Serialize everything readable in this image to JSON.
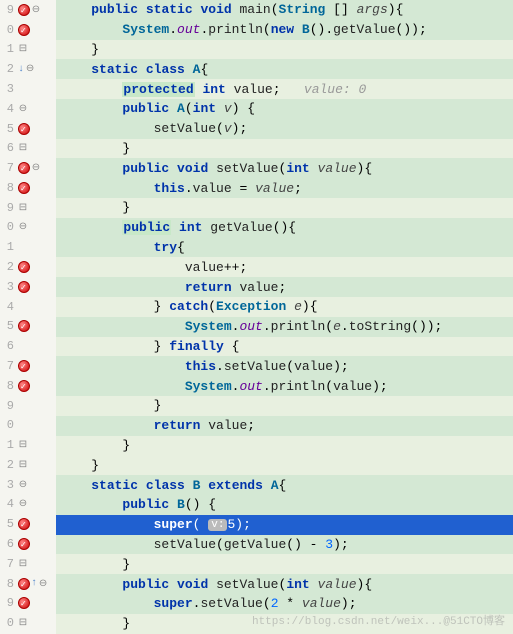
{
  "lines": [
    {
      "n": "9",
      "bp": true,
      "fold": "⊖",
      "cls": "hl-green",
      "tokens": [
        [
          "    ",
          ""
        ],
        [
          "public",
          "kw"
        ],
        [
          " ",
          ""
        ],
        [
          "static",
          "kw"
        ],
        [
          " ",
          ""
        ],
        [
          "void",
          "kw"
        ],
        [
          " ",
          ""
        ],
        [
          "main",
          "fn"
        ],
        [
          "(",
          ""
        ],
        [
          "String",
          "ty"
        ],
        [
          " [] ",
          ""
        ],
        [
          "args",
          "param"
        ],
        [
          "){",
          ""
        ]
      ]
    },
    {
      "n": "0",
      "bp": true,
      "cls": "hl-green",
      "tokens": [
        [
          "        ",
          ""
        ],
        [
          "System",
          "ty"
        ],
        [
          ".",
          ""
        ],
        [
          "out",
          "fi"
        ],
        [
          ".",
          ""
        ],
        [
          "println",
          "fn"
        ],
        [
          "(",
          ""
        ],
        [
          "new",
          "kw"
        ],
        [
          " ",
          ""
        ],
        [
          "B",
          "ty"
        ],
        [
          "().",
          ""
        ],
        [
          "getValue",
          "fn"
        ],
        [
          "());",
          ""
        ]
      ]
    },
    {
      "n": "1",
      "fold": "⊟",
      "cls": "hl-lightgreen",
      "tokens": [
        [
          "    }",
          ""
        ]
      ]
    },
    {
      "n": "2",
      "fold": "⊖",
      "arrow": "↓",
      "cls": "hl-green",
      "tokens": [
        [
          "    ",
          ""
        ],
        [
          "static",
          "kw"
        ],
        [
          " ",
          ""
        ],
        [
          "class",
          "kw"
        ],
        [
          " ",
          ""
        ],
        [
          "A",
          "ty"
        ],
        [
          "{",
          ""
        ]
      ]
    },
    {
      "n": "3",
      "cls": "hl-lightgreen",
      "tokens": [
        [
          "        ",
          ""
        ],
        [
          "protected",
          "kw hlbox"
        ],
        [
          " ",
          ""
        ],
        [
          "int",
          "kw"
        ],
        [
          " ",
          ""
        ],
        [
          "value",
          "id"
        ],
        [
          ";   ",
          ""
        ],
        [
          "value: 0",
          "cm"
        ]
      ]
    },
    {
      "n": "4",
      "fold": "⊖",
      "cls": "hl-green",
      "tokens": [
        [
          "        ",
          ""
        ],
        [
          "public",
          "kw"
        ],
        [
          " ",
          ""
        ],
        [
          "A",
          "ty"
        ],
        [
          "(",
          ""
        ],
        [
          "int",
          "kw"
        ],
        [
          " ",
          ""
        ],
        [
          "v",
          "param"
        ],
        [
          ") {",
          ""
        ]
      ]
    },
    {
      "n": "5",
      "bp": true,
      "cls": "hl-green",
      "tokens": [
        [
          "            ",
          ""
        ],
        [
          "setValue",
          "fn"
        ],
        [
          "(",
          ""
        ],
        [
          "v",
          "param"
        ],
        [
          ");",
          ""
        ]
      ]
    },
    {
      "n": "6",
      "fold": "⊟",
      "cls": "hl-lightgreen",
      "tokens": [
        [
          "        }",
          ""
        ]
      ]
    },
    {
      "n": "7",
      "bp": true,
      "fold": "⊖",
      "cls": "hl-green",
      "tokens": [
        [
          "        ",
          ""
        ],
        [
          "public",
          "kw"
        ],
        [
          " ",
          ""
        ],
        [
          "void",
          "kw"
        ],
        [
          " ",
          ""
        ],
        [
          "setValue",
          "fn"
        ],
        [
          "(",
          ""
        ],
        [
          "int",
          "kw"
        ],
        [
          " ",
          ""
        ],
        [
          "value",
          "param"
        ],
        [
          "){",
          ""
        ]
      ]
    },
    {
      "n": "8",
      "bp": true,
      "cls": "hl-green",
      "tokens": [
        [
          "            ",
          ""
        ],
        [
          "this",
          "kw"
        ],
        [
          ".",
          ""
        ],
        [
          "value",
          "id"
        ],
        [
          " = ",
          ""
        ],
        [
          "value",
          "param"
        ],
        [
          ";",
          ""
        ]
      ]
    },
    {
      "n": "9",
      "fold": "⊟",
      "cls": "hl-lightgreen",
      "tokens": [
        [
          "        }",
          ""
        ]
      ]
    },
    {
      "n": "0",
      "fold": "⊖",
      "cls": "hl-green",
      "tokens": [
        [
          "        ",
          ""
        ],
        [
          "public",
          "kw hlbox"
        ],
        [
          " ",
          ""
        ],
        [
          "int",
          "kw"
        ],
        [
          " ",
          ""
        ],
        [
          "getValue",
          "fn"
        ],
        [
          "(){",
          ""
        ]
      ]
    },
    {
      "n": "1",
      "cls": "hl-green",
      "tokens": [
        [
          "            ",
          ""
        ],
        [
          "try",
          "kw"
        ],
        [
          "{",
          ""
        ]
      ]
    },
    {
      "n": "2",
      "bp": true,
      "cls": "hl-lightgreen",
      "tokens": [
        [
          "                ",
          ""
        ],
        [
          "value",
          "id"
        ],
        [
          "++;",
          ""
        ]
      ]
    },
    {
      "n": "3",
      "bp": true,
      "cls": "hl-green",
      "tokens": [
        [
          "                ",
          ""
        ],
        [
          "return",
          "kw"
        ],
        [
          " ",
          ""
        ],
        [
          "value",
          "id"
        ],
        [
          ";",
          ""
        ]
      ]
    },
    {
      "n": "4",
      "cls": "hl-lightgreen",
      "tokens": [
        [
          "            } ",
          ""
        ],
        [
          "catch",
          "kw"
        ],
        [
          "(",
          ""
        ],
        [
          "Exception",
          "ty"
        ],
        [
          " ",
          ""
        ],
        [
          "e",
          "param"
        ],
        [
          "){",
          ""
        ]
      ]
    },
    {
      "n": "5",
      "bp": true,
      "cls": "hl-green",
      "tokens": [
        [
          "                ",
          ""
        ],
        [
          "System",
          "ty"
        ],
        [
          ".",
          ""
        ],
        [
          "out",
          "fi"
        ],
        [
          ".",
          ""
        ],
        [
          "println",
          "fn"
        ],
        [
          "(",
          ""
        ],
        [
          "e",
          "param"
        ],
        [
          ".",
          ""
        ],
        [
          "toString",
          "fn"
        ],
        [
          "());",
          ""
        ]
      ]
    },
    {
      "n": "6",
      "cls": "hl-lightgreen",
      "tokens": [
        [
          "            } ",
          ""
        ],
        [
          "finally",
          "kw"
        ],
        [
          " {",
          ""
        ]
      ]
    },
    {
      "n": "7",
      "bp": true,
      "cls": "hl-green",
      "tokens": [
        [
          "                ",
          ""
        ],
        [
          "this",
          "kw"
        ],
        [
          ".",
          ""
        ],
        [
          "setValue",
          "fn"
        ],
        [
          "(",
          ""
        ],
        [
          "value",
          "id"
        ],
        [
          ");",
          ""
        ]
      ]
    },
    {
      "n": "8",
      "bp": true,
      "cls": "hl-green",
      "tokens": [
        [
          "                ",
          ""
        ],
        [
          "System",
          "ty"
        ],
        [
          ".",
          ""
        ],
        [
          "out",
          "fi"
        ],
        [
          ".",
          ""
        ],
        [
          "println",
          "fn"
        ],
        [
          "(",
          ""
        ],
        [
          "value",
          "id"
        ],
        [
          ");",
          ""
        ]
      ]
    },
    {
      "n": "9",
      "cls": "hl-lightgreen",
      "tokens": [
        [
          "            }",
          ""
        ]
      ]
    },
    {
      "n": "0",
      "cls": "hl-green",
      "tokens": [
        [
          "            ",
          ""
        ],
        [
          "return",
          "kw"
        ],
        [
          " ",
          ""
        ],
        [
          "value",
          "id"
        ],
        [
          ";",
          ""
        ]
      ]
    },
    {
      "n": "1",
      "fold": "⊟",
      "cls": "hl-lightgreen",
      "tokens": [
        [
          "        }",
          ""
        ]
      ]
    },
    {
      "n": "2",
      "fold": "⊟",
      "cls": "hl-lightgreen",
      "tokens": [
        [
          "    }",
          ""
        ]
      ]
    },
    {
      "n": "3",
      "fold": "⊖",
      "cls": "hl-green",
      "tokens": [
        [
          "    ",
          ""
        ],
        [
          "static",
          "kw"
        ],
        [
          " ",
          ""
        ],
        [
          "class",
          "kw"
        ],
        [
          " ",
          ""
        ],
        [
          "B",
          "ty"
        ],
        [
          " ",
          ""
        ],
        [
          "extends",
          "kw"
        ],
        [
          " ",
          ""
        ],
        [
          "A",
          "ty"
        ],
        [
          "{",
          ""
        ]
      ]
    },
    {
      "n": "4",
      "fold": "⊖",
      "cls": "hl-green",
      "tokens": [
        [
          "        ",
          ""
        ],
        [
          "public",
          "kw"
        ],
        [
          " ",
          ""
        ],
        [
          "B",
          "ty"
        ],
        [
          "() {",
          ""
        ]
      ]
    },
    {
      "n": "5",
      "bp": true,
      "cls": "hl-blue",
      "tokens": [
        [
          "            ",
          ""
        ],
        [
          "super",
          "kw"
        ],
        [
          "( ",
          ""
        ],
        [
          "v:",
          "vbox"
        ],
        [
          "5",
          "num"
        ],
        [
          ");",
          ""
        ]
      ]
    },
    {
      "n": "6",
      "bp": true,
      "cls": "hl-green",
      "tokens": [
        [
          "            ",
          ""
        ],
        [
          "setValue",
          "fn"
        ],
        [
          "(",
          ""
        ],
        [
          "getValue",
          "fn"
        ],
        [
          "() - ",
          ""
        ],
        [
          "3",
          "num"
        ],
        [
          ");",
          ""
        ]
      ]
    },
    {
      "n": "7",
      "fold": "⊟",
      "cls": "hl-lightgreen",
      "tokens": [
        [
          "        }",
          ""
        ]
      ]
    },
    {
      "n": "8",
      "bp": true,
      "fold": "⊖",
      "arrow": "↑",
      "cls": "hl-green",
      "tokens": [
        [
          "        ",
          ""
        ],
        [
          "public",
          "kw"
        ],
        [
          " ",
          ""
        ],
        [
          "void",
          "kw"
        ],
        [
          " ",
          ""
        ],
        [
          "setValue",
          "fn"
        ],
        [
          "(",
          ""
        ],
        [
          "int",
          "kw"
        ],
        [
          " ",
          ""
        ],
        [
          "value",
          "param"
        ],
        [
          "){",
          ""
        ]
      ]
    },
    {
      "n": "9",
      "bp": true,
      "cls": "hl-green",
      "tokens": [
        [
          "            ",
          ""
        ],
        [
          "super",
          "kw"
        ],
        [
          ".",
          ""
        ],
        [
          "setValue",
          "fn"
        ],
        [
          "(",
          ""
        ],
        [
          "2",
          "num"
        ],
        [
          " * ",
          ""
        ],
        [
          "value",
          "param"
        ],
        [
          ");",
          ""
        ]
      ]
    },
    {
      "n": "0",
      "fold": "⊟",
      "cls": "hl-lightgreen",
      "tokens": [
        [
          "        }",
          ""
        ]
      ]
    }
  ],
  "watermark": "https://blog.csdn.net/weix...@51CTO博客"
}
